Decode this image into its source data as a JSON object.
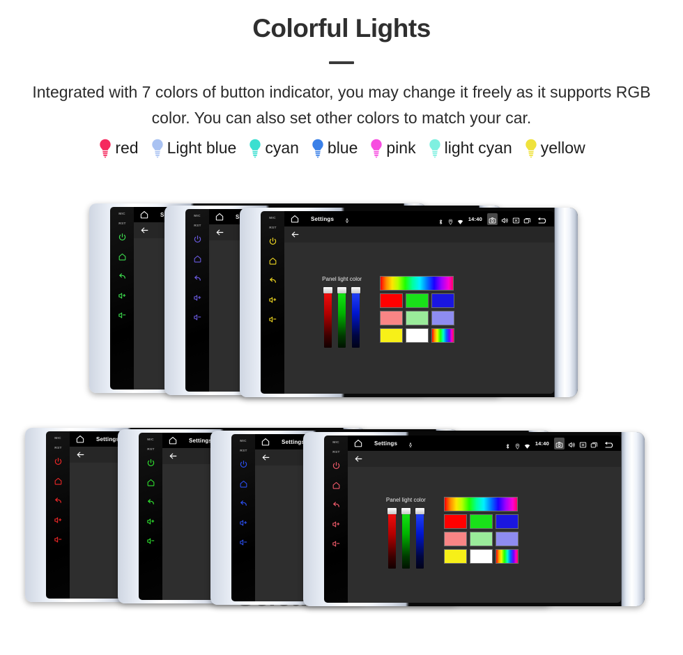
{
  "header": {
    "title": "Colorful Lights",
    "subtitle": "Integrated with 7 colors of button indicator, you may change it freely as it supports RGB color. You can also set other colors to match your car."
  },
  "legend": {
    "items": [
      {
        "label": "red",
        "color": "#f5295e"
      },
      {
        "label": "Light blue",
        "color": "#a9c2f2"
      },
      {
        "label": "cyan",
        "color": "#3bdfd0"
      },
      {
        "label": "blue",
        "color": "#3a80e8"
      },
      {
        "label": "pink",
        "color": "#f74ce0"
      },
      {
        "label": "light cyan",
        "color": "#7ff0e0"
      },
      {
        "label": "yellow",
        "color": "#efe23c"
      }
    ]
  },
  "device_ui": {
    "status_bar": {
      "title": "Settings",
      "clock": "14:40",
      "icons": [
        "home-icon",
        "mic-icon",
        "bluetooth-icon",
        "location-icon",
        "wifi-icon",
        "camera-icon",
        "volume-icon",
        "close-box-icon",
        "recents-icon",
        "back-icon"
      ]
    },
    "action_bar": {
      "back_label": "back-arrow-icon"
    },
    "side_keys": {
      "labels": [
        "MIC",
        "RST"
      ],
      "icons": [
        "power-icon",
        "home-icon",
        "back-icon",
        "volume-up-icon",
        "volume-down-icon"
      ]
    },
    "panel": {
      "label": "Panel light color",
      "sliders": [
        {
          "name": "red",
          "value": 100
        },
        {
          "name": "green",
          "value": 100
        },
        {
          "name": "blue",
          "value": 100
        }
      ],
      "swatches": [
        [
          "#ff0000",
          "#19e119",
          "#1a16e0"
        ],
        [
          "#f98585",
          "#9aeb9a",
          "#8e8cf0"
        ],
        [
          "#f7f018",
          "#ffffff",
          "rainbow"
        ]
      ],
      "gradient_bar": "rainbow"
    }
  },
  "groups": {
    "top": {
      "devices": [
        {
          "key_color": "#3ddc4e",
          "position": 0
        },
        {
          "key_color": "#6a5ae0",
          "position": 1
        },
        {
          "key_color": "#f0d720",
          "position": 2
        }
      ]
    },
    "bottom": {
      "devices": [
        {
          "key_color": "#ef2727",
          "position": 0
        },
        {
          "key_color": "#2fe02f",
          "position": 1
        },
        {
          "key_color": "#2b4ff0",
          "position": 2
        },
        {
          "key_color": "#ef5a6a",
          "position": 3
        }
      ]
    }
  },
  "watermark": {
    "text": "Seicane"
  }
}
